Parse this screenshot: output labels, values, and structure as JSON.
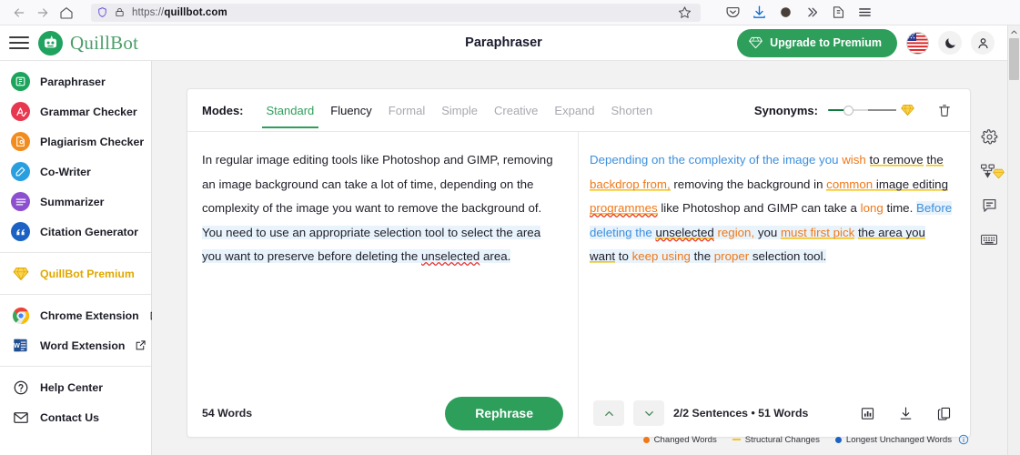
{
  "browser": {
    "url_prefix": "https://",
    "url_domain": "quillbot.com",
    "back_icon": "back-arrow-icon",
    "forward_icon": "forward-arrow-icon",
    "home_icon": "home-icon",
    "shield_icon": "shield-icon",
    "lock_icon": "lock-icon",
    "bookmark_icon": "star-icon",
    "pocket_icon": "pocket-icon",
    "download_icon": "download-icon",
    "account_icon": "account-circle-icon",
    "overflow_icon": "chevron-double-right-icon",
    "extensions_icon": "extensions-icon",
    "menu_icon": "hamburger-menu-icon"
  },
  "header": {
    "menu_icon": "hamburger-menu-icon",
    "brand": "QuillBot",
    "brand_icon": "quillbot-robot-icon",
    "title": "Paraphraser",
    "upgrade_label": "Upgrade to Premium",
    "upgrade_icon": "diamond-icon",
    "flag_icon": "us-flag-icon",
    "theme_icon": "moon-icon",
    "profile_icon": "person-icon",
    "accent_green": "#2e9e5b"
  },
  "sidebar": {
    "groups": [
      {
        "items": [
          {
            "label": "Paraphraser",
            "icon": "paraphraser-icon",
            "color": "#1ba45b"
          },
          {
            "label": "Grammar Checker",
            "icon": "grammar-checker-icon",
            "color": "#e8384f"
          },
          {
            "label": "Plagiarism Checker",
            "icon": "plagiarism-checker-icon",
            "color": "#f28c1e"
          },
          {
            "label": "Co-Writer",
            "icon": "co-writer-icon",
            "color": "#2a9fe0"
          },
          {
            "label": "Summarizer",
            "icon": "summarizer-icon",
            "color": "#8b4fd0"
          },
          {
            "label": "Citation Generator",
            "icon": "citation-generator-icon",
            "color": "#1b62c4"
          }
        ]
      },
      {
        "items": [
          {
            "label": "QuillBot Premium",
            "icon": "diamond-icon",
            "color": "#e0a800",
            "premium": true
          }
        ]
      },
      {
        "items": [
          {
            "label": "Chrome Extension",
            "icon": "chrome-icon",
            "color": "#4285f4",
            "external": true
          },
          {
            "label": "Word Extension",
            "icon": "word-icon",
            "color": "#1b62c4",
            "external": true
          }
        ]
      },
      {
        "items": [
          {
            "label": "Help Center",
            "icon": "help-circle-icon",
            "color": "#2b2b33",
            "plain": true
          },
          {
            "label": "Contact Us",
            "icon": "mail-icon",
            "color": "#2b2b33",
            "plain": true
          }
        ]
      }
    ]
  },
  "modes": {
    "label": "Modes:",
    "items": [
      {
        "label": "Standard",
        "state": "active"
      },
      {
        "label": "Fluency",
        "state": "dark"
      },
      {
        "label": "Formal",
        "state": "muted"
      },
      {
        "label": "Simple",
        "state": "muted"
      },
      {
        "label": "Creative",
        "state": "muted"
      },
      {
        "label": "Expand",
        "state": "muted"
      },
      {
        "label": "Shorten",
        "state": "muted"
      }
    ],
    "synonyms_label": "Synonyms:",
    "synonyms_value": 23,
    "synonyms_premium_icon": "diamond-icon",
    "delete_icon": "trash-icon"
  },
  "input_pane": {
    "text": "In regular image editing tools like Photoshop and GIMP, removing an image background can take a lot of time, depending on the complexity of the image you want to remove the background of. You need to use an appropriate selection tool to select the area you want to preserve before deleting the unselected area.",
    "segments": [
      {
        "t": "In regular image editing tools like Photoshop and GIMP, removing an image background can take a lot of time, depending on the complexity of the image you want to remove the background of. ",
        "style": "plain"
      },
      {
        "t": "You need to use an appropriate selection tool to select the area you want to preserve before deleting the ",
        "style": "highlight"
      },
      {
        "t": "unselected",
        "style": "highlight-spell"
      },
      {
        "t": " area.",
        "style": "highlight"
      }
    ],
    "word_count": "54 Words",
    "rephrase_label": "Rephrase"
  },
  "output_pane": {
    "text": "Depending on the complexity of the image you wish to remove the backdrop from, removing the background in common image editing programmes like Photoshop and GIMP can take a long time. Before deleting the unselected region, you must first pick the area you want to keep using the proper selection tool.",
    "segments": [
      {
        "t": "Depending on the complexity of the image you ",
        "style": "blue"
      },
      {
        "t": "wish",
        "style": "orange"
      },
      {
        "t": " ",
        "style": "plain"
      },
      {
        "t": "to remove",
        "style": "struct"
      },
      {
        "t": " ",
        "style": "plain"
      },
      {
        "t": "the",
        "style": "struct"
      },
      {
        "t": " ",
        "style": "plain"
      },
      {
        "t": "backdrop from,",
        "style": "orange-struct"
      },
      {
        "t": " removing the background in ",
        "style": "plain"
      },
      {
        "t": "common",
        "style": "orange-struct"
      },
      {
        "t": " ",
        "style": "struct"
      },
      {
        "t": "image editing",
        "style": "struct"
      },
      {
        "t": " ",
        "style": "plain"
      },
      {
        "t": "programmes",
        "style": "orange-struct-spell"
      },
      {
        "t": " like Photoshop and GIMP can take a ",
        "style": "plain"
      },
      {
        "t": "long",
        "style": "orange"
      },
      {
        "t": " time. ",
        "style": "plain"
      },
      {
        "t": "Before deleting the ",
        "style": "blue-highlight"
      },
      {
        "t": "unselected",
        "style": "struct-spell-highlight"
      },
      {
        "t": " ",
        "style": "highlight"
      },
      {
        "t": "region,",
        "style": "orange-highlight"
      },
      {
        "t": " you ",
        "style": "highlight"
      },
      {
        "t": "must first pick",
        "style": "orange-struct-highlight"
      },
      {
        "t": " ",
        "style": "highlight"
      },
      {
        "t": "the area you want",
        "style": "struct-highlight"
      },
      {
        "t": " to ",
        "style": "highlight"
      },
      {
        "t": "keep using",
        "style": "orange-highlight"
      },
      {
        "t": " the ",
        "style": "highlight"
      },
      {
        "t": "proper",
        "style": "orange-highlight"
      },
      {
        "t": " selection tool.",
        "style": "highlight"
      }
    ],
    "sentence_counter": "2/2 Sentences • 51 Words",
    "prev_icon": "chevron-up-icon",
    "next_icon": "chevron-down-icon",
    "stats_icon": "bar-chart-icon",
    "download_icon": "download-icon",
    "copy_icon": "copy-icon"
  },
  "legend": {
    "items": [
      {
        "label": "Changed Words",
        "marker": "dot",
        "color": "#f07818"
      },
      {
        "label": "Structural Changes",
        "marker": "dash",
        "color": "#f5c518"
      },
      {
        "label": "Longest Unchanged Words",
        "marker": "dot",
        "color": "#1b62c4"
      }
    ],
    "info_icon": "info-circle-icon"
  },
  "rail": {
    "items": [
      {
        "icon": "gear-icon",
        "name": "settings"
      },
      {
        "icon": "flowchart-icon",
        "name": "structure",
        "premium": true
      },
      {
        "icon": "comment-icon",
        "name": "feedback"
      },
      {
        "icon": "keyboard-icon",
        "name": "shortcuts"
      }
    ]
  }
}
